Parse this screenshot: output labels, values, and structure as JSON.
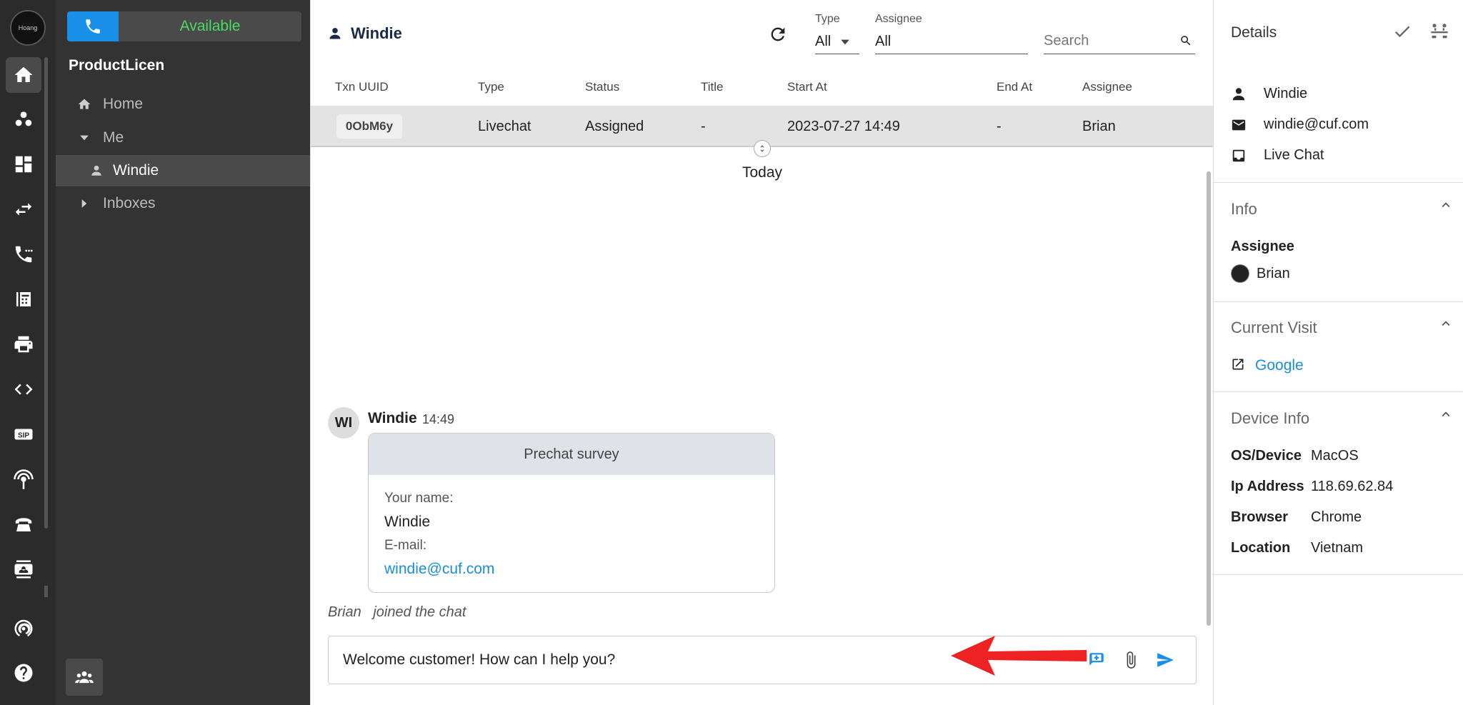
{
  "rail": {
    "avatar_text": "Hoang",
    "items": [
      "home-icon",
      "users-icon",
      "dashboard-icon",
      "transfer-icon",
      "call-log-icon",
      "phonebook-icon",
      "printer-icon",
      "code-icon",
      "sip-icon",
      "antenna-icon",
      "telephone-icon",
      "contact-card-icon",
      "broadcast-icon",
      "help-icon"
    ],
    "sip_label": "SIP"
  },
  "sidenav": {
    "status": "Available",
    "org_name": "ProductLicen",
    "items": [
      {
        "label": "Home"
      },
      {
        "label": "Me"
      },
      {
        "label": "Windie"
      },
      {
        "label": "Inboxes"
      }
    ]
  },
  "topbar": {
    "title": "Windie",
    "type_label": "Type",
    "type_value": "All",
    "assignee_label": "Assignee",
    "assignee_value": "All",
    "search_placeholder": "Search"
  },
  "table": {
    "headers": [
      "Txn UUID",
      "Type",
      "Status",
      "Title",
      "Start At",
      "End At",
      "Assignee"
    ],
    "row": {
      "uuid": "0ObM6y",
      "type": "Livechat",
      "status": "Assigned",
      "title": "-",
      "start_at": "2023-07-27 14:49",
      "end_at": "-",
      "assignee": "Brian"
    }
  },
  "chat": {
    "day_divider": "Today",
    "message": {
      "avatar": "WI",
      "author": "Windie",
      "time": "14:49",
      "survey_title": "Prechat survey",
      "name_label": "Your name:",
      "name_value": "Windie",
      "email_label": "E-mail:",
      "email_value": "windie@cuf.com"
    },
    "join_note": "Brian   joined the chat",
    "composer_value": "Welcome customer! How can I help you?"
  },
  "details": {
    "title": "Details",
    "contact": {
      "name": "Windie",
      "email": "windie@cuf.com",
      "channel": "Live Chat"
    },
    "info_title": "Info",
    "assignee_label": "Assignee",
    "assignee_name": "Brian",
    "visit_title": "Current Visit",
    "visit_link": "Google",
    "device_title": "Device Info",
    "device": {
      "os_label": "OS/Device",
      "os": "MacOS",
      "ip_label": "Ip Address",
      "ip": "118.69.62.84",
      "browser_label": "Browser",
      "browser": "Chrome",
      "location_label": "Location",
      "location": "Vietnam"
    }
  },
  "colors": {
    "accent": "#1a8fe8",
    "available": "#4cd964",
    "link": "#1a8fd8",
    "annotation_arrow": "#ee2222"
  }
}
